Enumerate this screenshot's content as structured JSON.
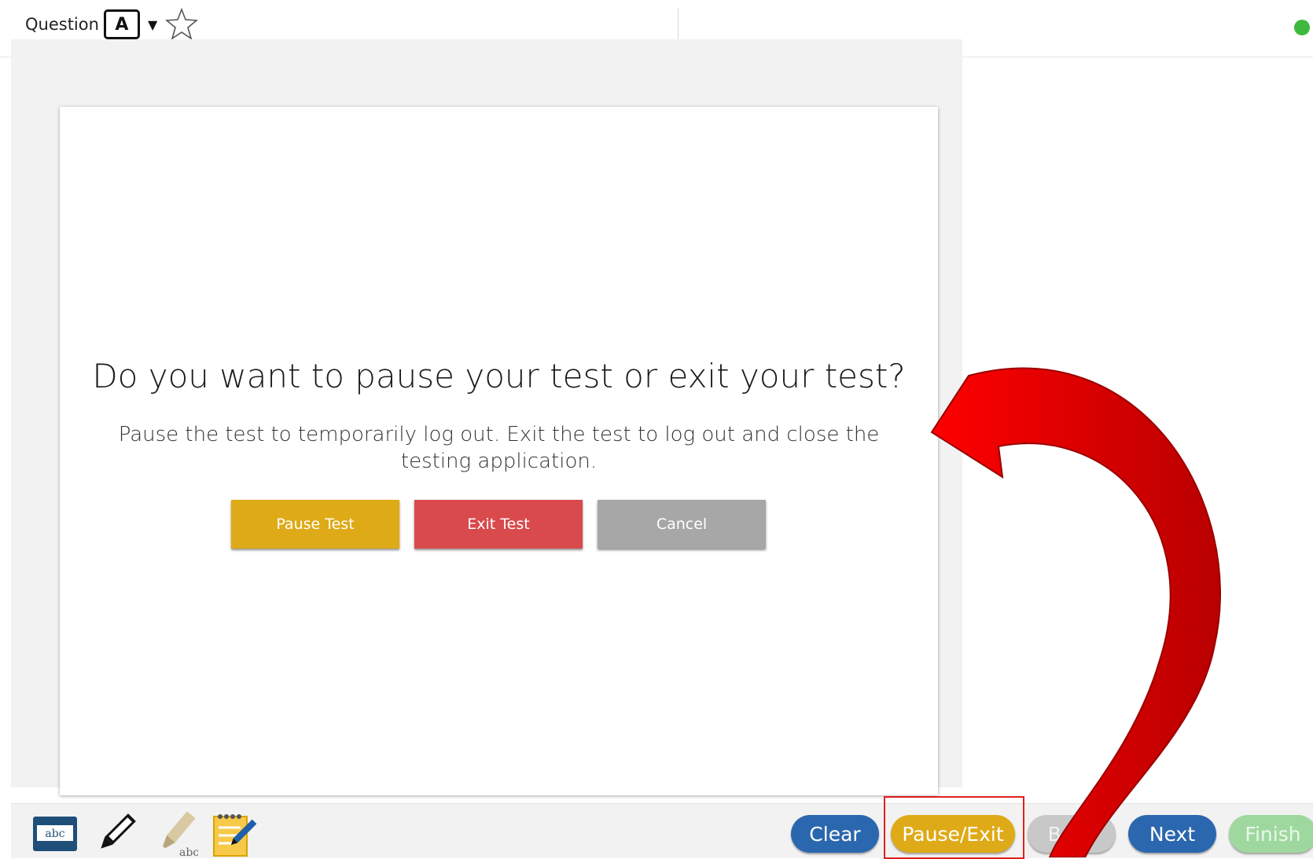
{
  "header": {
    "question_label": "Question",
    "question_letter": "A",
    "caret": "▼",
    "star_icon": "star-outline-icon",
    "status_color": "#3dba3d"
  },
  "dialog": {
    "title": "Do you want to pause your test or exit your test?",
    "message": "Pause the test to temporarily log out. Exit the test to log out and close the testing application.",
    "buttons": {
      "pause": "Pause Test",
      "exit": "Exit Test",
      "cancel": "Cancel"
    }
  },
  "toolbar": {
    "tools": [
      {
        "name": "line-reader-icon",
        "text": "abc"
      },
      {
        "name": "pencil-icon"
      },
      {
        "name": "highlighter-icon",
        "text": "abc"
      },
      {
        "name": "notepad-icon"
      }
    ],
    "clear": "Clear",
    "pause_exit": "Pause/Exit",
    "back": "Back",
    "next": "Next",
    "finish": "Finish"
  },
  "colors": {
    "accent_blue": "#2b67ae",
    "pause_yellow": "#deaa17",
    "exit_red": "#d94a4c",
    "cancel_gray": "#a7a7a7",
    "annotation_red": "#e00000"
  }
}
